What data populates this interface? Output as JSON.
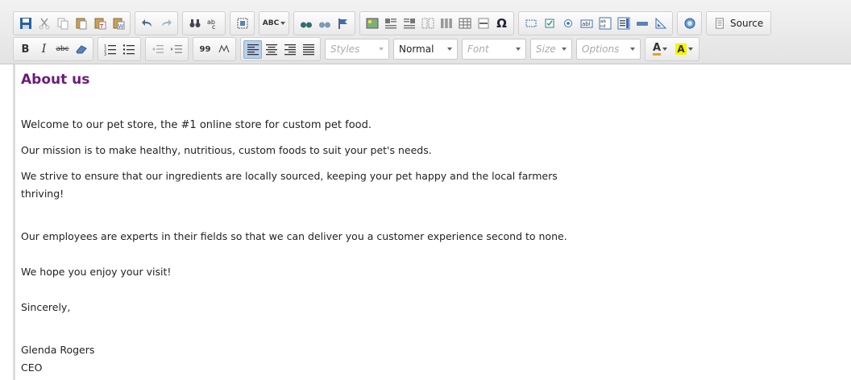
{
  "toolbar": {
    "source_label": "Source",
    "styles_placeholder": "Styles",
    "format_value": "Normal",
    "font_placeholder": "Font",
    "size_placeholder": "Size",
    "options_placeholder": "Options",
    "bold_glyph": "B",
    "italic_glyph": "I",
    "strike_glyph": "abc",
    "text_color_glyph": "A",
    "bg_color_glyph": "A",
    "spell_glyph": "ABC",
    "omega_glyph": "Ω",
    "blockquote_glyph": "99"
  },
  "content": {
    "heading": "About us",
    "paragraphs": [
      "Welcome to our pet store, the #1 online store for custom pet food.",
      "Our mission is to make healthy, nutritious, custom foods to suit your pet's needs.",
      "We strive to ensure that our ingredients are locally sourced, keeping your pet happy and the local farmers",
      "thriving!",
      "Our employees are experts in their fields so that we can deliver you a customer experience second to none.",
      "We hope you enjoy your visit!",
      "Sincerely,",
      "Glenda Rogers",
      "CEO"
    ]
  },
  "colors": {
    "heading": "#6b1b7a",
    "toolbar_bg": "#e6e6e6",
    "active_button": "#b8cfe9"
  }
}
